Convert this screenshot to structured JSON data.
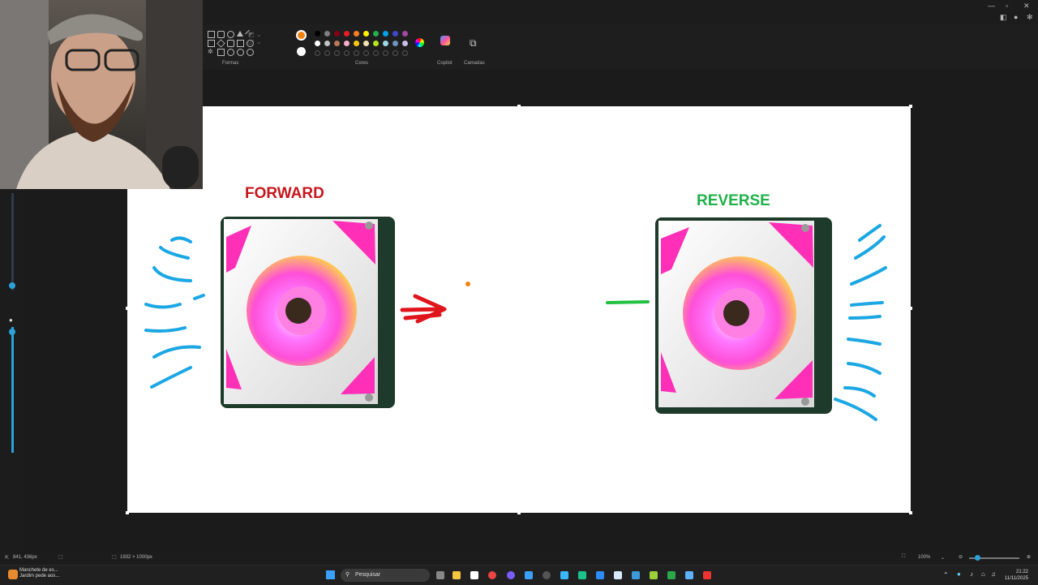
{
  "ribbon": {
    "groups": [
      "Formas",
      "Cores",
      "Copilot",
      "Camadas"
    ],
    "current_color": "#f2820f",
    "secondary_color": "#ffffff",
    "palette": [
      "#000000",
      "#7f7f7f",
      "#880015",
      "#ed1c24",
      "#ff7f27",
      "#fff200",
      "#22b14c",
      "#00a2e8",
      "#3f48cc",
      "#a349a4",
      "#ffffff",
      "#c3c3c3",
      "#b97a57",
      "#ffaec9",
      "#ffc90e",
      "#efe4b0",
      "#b5e61d",
      "#99d9ea",
      "#7092be",
      "#c8bfe7"
    ]
  },
  "canvas": {
    "label_forward": "FORWARD",
    "label_reverse": "REVERSE",
    "forward_color": "#c7161d",
    "reverse_color": "#20b14a",
    "airflow_color": "#1ba7e3"
  },
  "status": {
    "cursor_pos": "841, 436px",
    "canvas_size": "1932 × 1000px",
    "zoom": "100%"
  },
  "taskbar": {
    "news_title": "Manchete de es...",
    "news_sub": "Jardim pede aos...",
    "search_placeholder": "Pesquisar",
    "time": "21:22",
    "date": "11/11/2025"
  }
}
